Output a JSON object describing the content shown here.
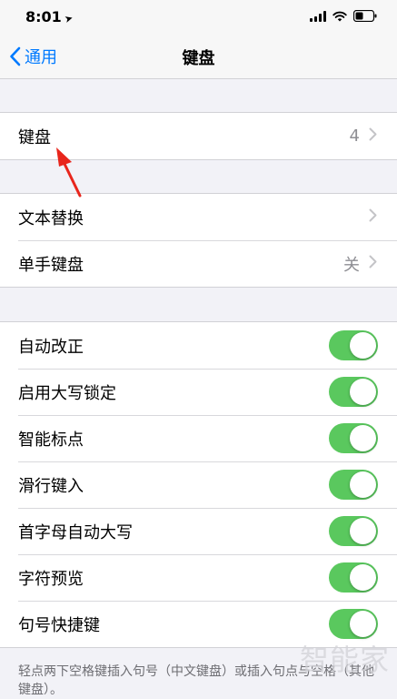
{
  "status": {
    "time": "8:01"
  },
  "nav": {
    "back_label": "通用",
    "title": "键盘"
  },
  "groups": {
    "keyboard": {
      "label": "键盘",
      "value": "4"
    },
    "text": [
      {
        "label": "文本替换",
        "value": ""
      },
      {
        "label": "单手键盘",
        "value": "关"
      }
    ],
    "toggles": [
      {
        "label": "自动改正",
        "on": true
      },
      {
        "label": "启用大写锁定",
        "on": true
      },
      {
        "label": "智能标点",
        "on": true
      },
      {
        "label": "滑行键入",
        "on": true
      },
      {
        "label": "首字母自动大写",
        "on": true
      },
      {
        "label": "字符预览",
        "on": true
      },
      {
        "label": "句号快捷键",
        "on": true
      }
    ]
  },
  "footer": {
    "text": "轻点两下空格键插入句号（中文键盘）或插入句点与空格（其他键盘）。"
  },
  "watermark": {
    "text": "智能家"
  },
  "colors": {
    "accent": "#007aff",
    "toggle_on": "#5ac85e",
    "annotation": "#e8261c"
  }
}
